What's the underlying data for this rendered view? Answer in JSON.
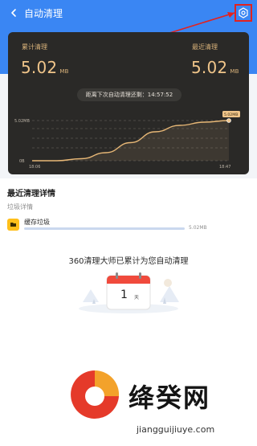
{
  "nav": {
    "title": "自动清理"
  },
  "stats": {
    "total_label": "累计清理",
    "total_value": "5.02",
    "total_unit": "MB",
    "recent_label": "最近清理",
    "recent_value": "5.02",
    "recent_unit": "MB",
    "timer_text": "距离下次自动清理还剩：14:57:52"
  },
  "chart_data": {
    "type": "area",
    "x": [
      "18:06",
      "18:47"
    ],
    "xlabel": "",
    "ylabel": "",
    "y_ticks": [
      "5.02MB",
      "0B"
    ],
    "series": [
      {
        "values": [
          0.0,
          0.0,
          0.05,
          0.2,
          0.45,
          0.72,
          0.88,
          0.96,
          1.0
        ]
      }
    ],
    "annotation": "5.02MB",
    "grid": true
  },
  "details": {
    "section_title": "最近清理详情",
    "sub_title": "垃圾详情",
    "items": [
      {
        "name": "缓存垃圾",
        "size": "5.02MB",
        "progress": 1.0
      }
    ]
  },
  "summary": {
    "text": "360清理大师已累计为您自动清理",
    "days_value": "1",
    "days_unit": "天"
  },
  "watermark": {
    "text": "绛癸网",
    "url": "jiangguijiuye.com"
  },
  "colors": {
    "header_blue": "#3a86f3",
    "card_dark": "#2a2927",
    "gold": "#f0c58a",
    "highlight_red": "#e3221e"
  }
}
